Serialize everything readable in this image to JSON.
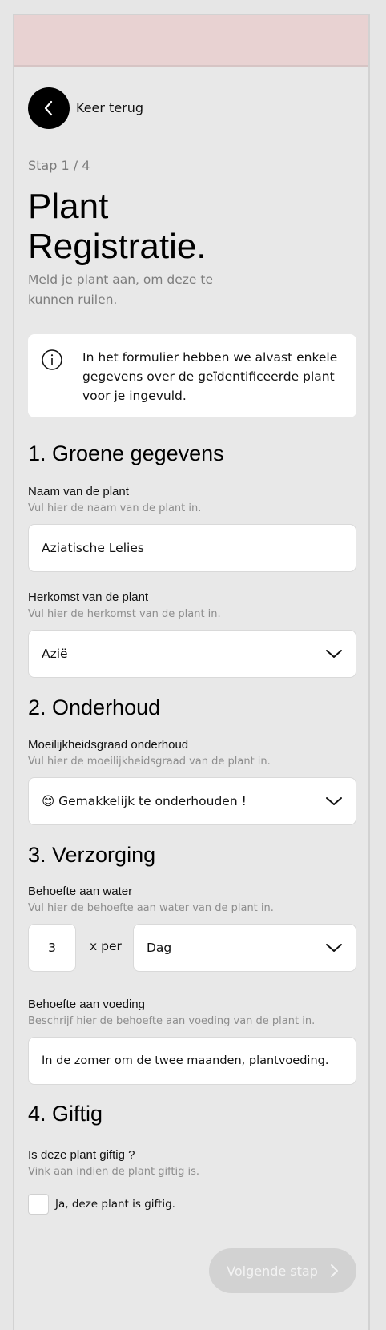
{
  "colors": {
    "background": "#e8e8e8",
    "top_band": "#e8d2d2",
    "card": "#ffffff",
    "button_disabled": "#d2d2d2",
    "muted_text": "#7d7d7d"
  },
  "header": {
    "back_label": "Keer terug",
    "back_icon": "chevron-left-icon"
  },
  "step_indicator": "Stap 1 / 4",
  "page_title_line1": "Plant",
  "page_title_line2": "Registratie.",
  "page_subtitle": "Meld je plant aan, om deze te kunnen ruilen.",
  "info": {
    "icon": "info-icon",
    "text": "In het formulier hebben we alvast enkele gegevens over de geïdentificeerde plant voor je ingevuld."
  },
  "section1": {
    "title": "1.  Groene gegevens",
    "name_label": "Naam van de plant",
    "name_hint": "Vul hier de naam van de plant in.",
    "name_value": "Aziatische Lelies",
    "origin_label": "Herkomst van de plant",
    "origin_hint": "Vul hier de herkomst van de plant in.",
    "origin_value": "Azië"
  },
  "section2": {
    "title": "2.  Onderhoud",
    "difficulty_label": "Moeilijkheidsgraad onderhoud",
    "difficulty_hint": "Vul hier de moeilijkheidsgraad van de plant in.",
    "difficulty_value": "😊 Gemakkelijk te onderhouden !"
  },
  "section3": {
    "title": "3. Verzorging",
    "water_label": "Behoefte aan water",
    "water_hint": "Vul hier de behoefte aan water van de plant in.",
    "water_amount": "3",
    "water_per": "x per",
    "water_period": "Dag",
    "food_label": "Behoefte aan voeding",
    "food_hint": "Beschrijf hier de behoefte aan voeding van de plant in.",
    "food_value": "In de zomer om de twee maanden, plantvoeding."
  },
  "section4": {
    "title": "4. Giftig",
    "toxic_label": "Is deze plant giftig ?",
    "toxic_hint": "Vink aan indien de plant giftig is.",
    "toxic_checkbox_label": "Ja, deze plant is giftig.",
    "toxic_checked": false
  },
  "footer": {
    "next_label": "Volgende stap",
    "next_icon": "chevron-right-icon"
  }
}
